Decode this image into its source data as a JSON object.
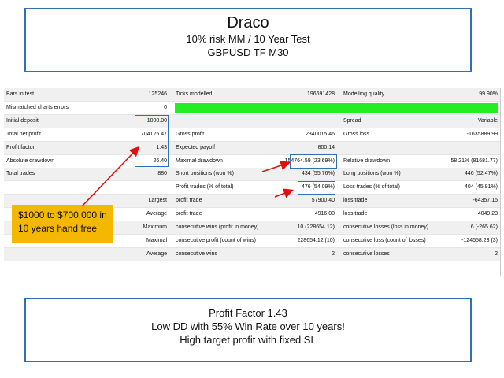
{
  "header": {
    "title": "Draco",
    "subtitle": "10% risk MM / 10 Year Test",
    "symbol": "GBPUSD TF M30"
  },
  "report": {
    "rows": [
      {
        "c1l": "Bars in test",
        "c1v": "125246",
        "c2l": "Ticks modelled",
        "c2v": "196691428",
        "c3l": "Modelling quality",
        "c3v": "99.90%"
      },
      {
        "c1l": "Mismatched charts errors",
        "c1v": "0",
        "c2l": "",
        "c2v": "",
        "c3l": "",
        "c3v": ""
      },
      {
        "c1l": "Initial deposit",
        "c1v": "1000.00",
        "c2l": "",
        "c2v": "",
        "c3l": "Spread",
        "c3v": "Variable"
      },
      {
        "c1l": "Total net profit",
        "c1v": "704125.47",
        "c2l": "Gross profit",
        "c2v": "2340015.46",
        "c3l": "Gross loss",
        "c3v": "-1635889.99"
      },
      {
        "c1l": "Profit factor",
        "c1v": "1.43",
        "c2l": "Expected payoff",
        "c2v": "800.14",
        "c3l": "",
        "c3v": ""
      },
      {
        "c1l": "Absolute drawdown",
        "c1v": "26.40",
        "c2l": "Maximal drawdown",
        "c2v": "154764.59 (23.69%)",
        "c3l": "Relative drawdown",
        "c3v": "58.21% (81681.77)"
      },
      {
        "c1l": "Total trades",
        "c1v": "880",
        "c2l": "Short positions (won %)",
        "c2v": "434 (55.76%)",
        "c3l": "Long positions (won %)",
        "c3v": "446 (52.47%)"
      },
      {
        "c1l": "",
        "c1v": "",
        "c2l": "Profit trades (% of total)",
        "c2v": "476 (54.09%)",
        "c3l": "Loss trades (% of total)",
        "c3v": "404 (45.91%)"
      },
      {
        "c1l": "",
        "c1v": "Largest",
        "c2l": "profit trade",
        "c2v": "57900.40",
        "c3l": "loss trade",
        "c3v": "-64357.15"
      },
      {
        "c1l": "",
        "c1v": "Average",
        "c2l": "profit trade",
        "c2v": "4916.00",
        "c3l": "loss trade",
        "c3v": "-4049.23"
      },
      {
        "c1l": "",
        "c1v": "Maximum",
        "c2l": "consecutive wins (profit in money)",
        "c2v": "10 (228654.12)",
        "c3l": "consecutive losses (loss in money)",
        "c3v": "6 (-265.62)"
      },
      {
        "c1l": "",
        "c1v": "Maximal",
        "c2l": "consecutive profit (count of wins)",
        "c2v": "228654.12 (10)",
        "c3l": "consecutive loss (count of losses)",
        "c3v": "-124558.23 (3)"
      },
      {
        "c1l": "",
        "c1v": "Average",
        "c2l": "consecutive wins",
        "c2v": "2",
        "c3l": "consecutive losses",
        "c3v": "2"
      }
    ]
  },
  "callout": {
    "line1": "$1000 to $700,000 in",
    "line2": "10 years hand free"
  },
  "footer": {
    "line1": "Profit Factor 1.43",
    "line2": "Low DD with 55% Win Rate over 10 years!",
    "line3": "High target profit with fixed SL"
  },
  "colors": {
    "accent_blue": "#2e6fb7",
    "quality_bar_green": "#22ee22",
    "callout_bg": "#f5b800",
    "arrow_red": "#e01010"
  }
}
